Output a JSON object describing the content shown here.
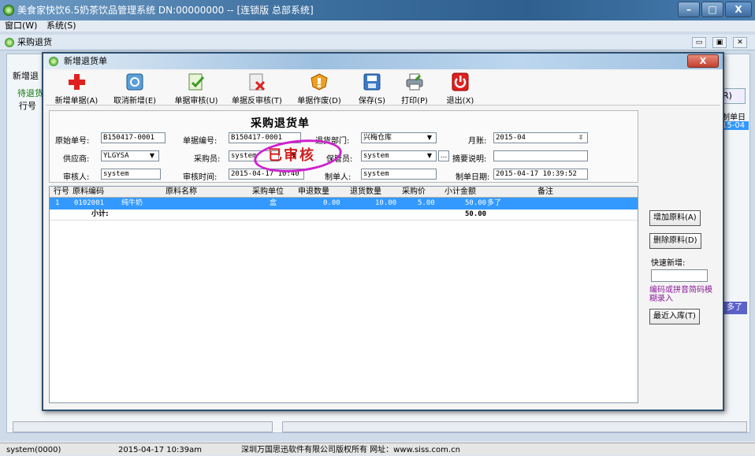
{
  "window": {
    "title": "美食家快饮6.5奶茶饮品管理系统 DN:00000000 -- [连锁版 总部系统]",
    "min": "–",
    "max": "□",
    "close": "X"
  },
  "menu": [
    "窗口(W)",
    "系统(S)"
  ],
  "child": {
    "title": "采购退货"
  },
  "bg": {
    "left1": "新增退",
    "left2": "待退货",
    "left3": "行号",
    "right_btn": "R)",
    "right_text": "制单日期",
    "right_date": "15-04",
    "purple": "多了",
    "col_hdr": "制单日"
  },
  "dialog": {
    "title": "新增退货单",
    "close": "X"
  },
  "toolbar": [
    {
      "label": "新增单据(A)",
      "icon": "plus-icon"
    },
    {
      "label": "取消新增(E)",
      "icon": "email-icon"
    },
    {
      "label": "单据审核(U)",
      "icon": "approve-icon"
    },
    {
      "label": "单据反审核(T)",
      "icon": "unapprove-icon"
    },
    {
      "label": "单据作废(D)",
      "icon": "void-icon"
    },
    {
      "label": "保存(S)",
      "icon": "save-icon"
    },
    {
      "label": "打印(P)",
      "icon": "print-icon"
    },
    {
      "label": "退出(X)",
      "icon": "power-icon"
    }
  ],
  "form": {
    "heading": "采购退货单",
    "orig_no_label": "原始单号:",
    "orig_no": "B150417-0001",
    "doc_no_label": "单据编号:",
    "doc_no": "B150417-0001",
    "dept_label": "退货部门:",
    "dept": "兴梅仓库",
    "month_label": "月账:",
    "month": "2015-04",
    "supplier_label": "供应商:",
    "supplier": "YLGYSA",
    "buyer_label": "采购员:",
    "buyer": "system",
    "keeper_label": "保管员:",
    "keeper": "system",
    "memo_label": "摘要说明:",
    "memo": "",
    "auditor_label": "审核人:",
    "auditor": "system",
    "audit_time_label": "审核时间:",
    "audit_time": "2015-04-17 10:40",
    "maker_label": "制单人:",
    "maker": "system",
    "make_date_label": "制单日期:",
    "make_date": "2015-04-17 10:39:52",
    "stamp": "已审核",
    "ellipsis": "..."
  },
  "grid": {
    "headers": [
      "行号",
      "原料编码",
      "原料名称",
      "采购单位",
      "申退数量",
      "退货数量",
      "采购价",
      "小计金额",
      "备注"
    ],
    "rows": [
      [
        "1",
        "0102001",
        "纯牛奶",
        "盒",
        "0.00",
        "10.00",
        "5.00",
        "50.00",
        "多了"
      ]
    ],
    "total_label": "小计:",
    "total_amount": "50.00"
  },
  "side": {
    "add_material": "增加原料(A)",
    "del_material": "删除原料(D)",
    "quick_add_label": "快速新增:",
    "quick_add_value": "",
    "hint": "编码或拼音简码模糊录入",
    "recent": "最近入库(T)"
  },
  "status": {
    "user": "system(0000)",
    "datetime": "2015-04-17 10:39am",
    "copyright": "深圳万国思迅软件有限公司版权所有 网址：www.siss.com.cn"
  }
}
